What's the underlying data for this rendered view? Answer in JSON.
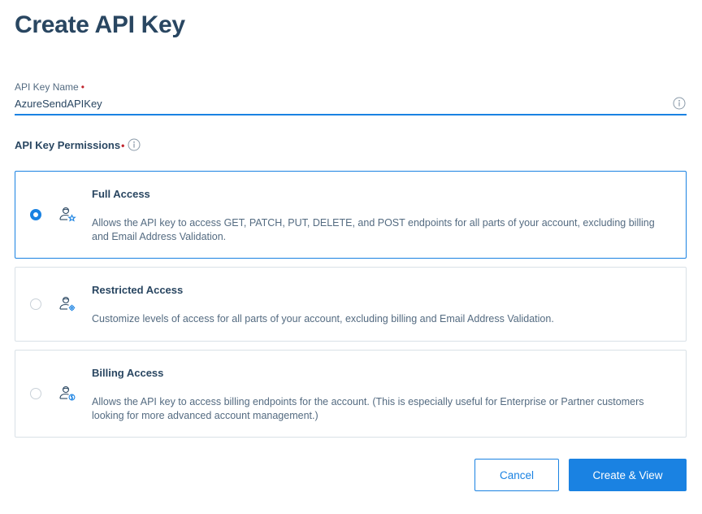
{
  "page": {
    "title": "Create API Key"
  },
  "api_key_name": {
    "label": "API Key Name",
    "required_mark": "•",
    "value": "AzureSendAPIKey",
    "info_icon": "info-circle-icon"
  },
  "permissions": {
    "label": "API Key Permissions",
    "required_mark": "•",
    "info_icon": "info-circle-icon",
    "selected": "Full Access",
    "options": [
      {
        "title": "Full Access",
        "description": "Allows the API key to access GET, PATCH, PUT, DELETE, and POST endpoints for all parts of your account, excluding billing and Email Address Validation.",
        "icon": "user-star-icon",
        "selected": true
      },
      {
        "title": "Restricted Access",
        "description": "Customize levels of access for all parts of your account, excluding billing and Email Address Validation.",
        "icon": "user-gear-icon",
        "selected": false
      },
      {
        "title": "Billing Access",
        "description": "Allows the API key to access billing endpoints for the account. (This is especially useful for Enterprise or Partner customers looking for more advanced account management.)",
        "icon": "user-dollar-icon",
        "selected": false
      }
    ]
  },
  "actions": {
    "cancel_label": "Cancel",
    "create_label": "Create & View"
  },
  "colors": {
    "accent": "#1a82e2",
    "heading": "#294661",
    "text": "#546b81",
    "required": "#c0232c",
    "border": "#d9e1e7"
  }
}
